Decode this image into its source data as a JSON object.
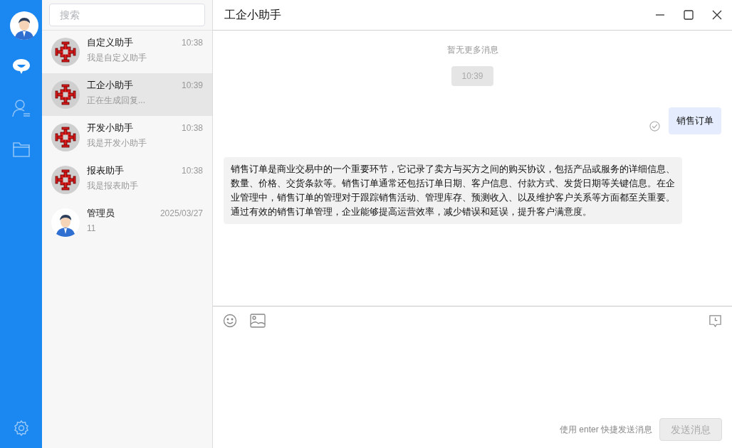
{
  "nav": [
    {
      "kind": "chat",
      "selected": true
    },
    {
      "kind": "contacts",
      "selected": false
    },
    {
      "kind": "folder",
      "selected": false
    }
  ],
  "search": {
    "placeholder": "搜索"
  },
  "conversations": [
    {
      "name": "自定义助手",
      "time": "10:38",
      "preview": "我是自定义助手",
      "kind": "bot",
      "selected": false
    },
    {
      "name": "工企小助手",
      "time": "10:39",
      "preview": "正在生成回复...",
      "kind": "bot",
      "selected": true
    },
    {
      "name": "开发小助手",
      "time": "10:38",
      "preview": "我是开发小助手",
      "kind": "bot",
      "selected": false
    },
    {
      "name": "报表助手",
      "time": "10:38",
      "preview": "我是报表助手",
      "kind": "bot",
      "selected": false
    },
    {
      "name": "管理员",
      "time": "2025/03/27",
      "preview": "11",
      "kind": "person",
      "selected": false
    }
  ],
  "chat": {
    "title": "工企小助手",
    "no_more": "暂无更多消息",
    "time_divider": "10:39",
    "messages": [
      {
        "kind": "outgoing",
        "text": "销售订单",
        "read": true
      },
      {
        "kind": "incoming",
        "text": "销售订单是商业交易中的一个重要环节，它记录了卖方与买方之间的购买协议，包括产品或服务的详细信息、数量、价格、交货条款等。销售订单通常还包括订单日期、客户信息、付款方式、发货日期等关键信息。在企业管理中，销售订单的管理对于跟踪销售活动、管理库存、预测收入、以及维护客户关系等方面都至关重要。通过有效的销售订单管理，企业能够提高运营效率，减少错误和延误，提升客户满意度。",
        "read": false
      }
    ]
  },
  "composer": {
    "hint": "使用 enter 快捷发送消息",
    "send": "发送消息",
    "send_disabled": true
  }
}
